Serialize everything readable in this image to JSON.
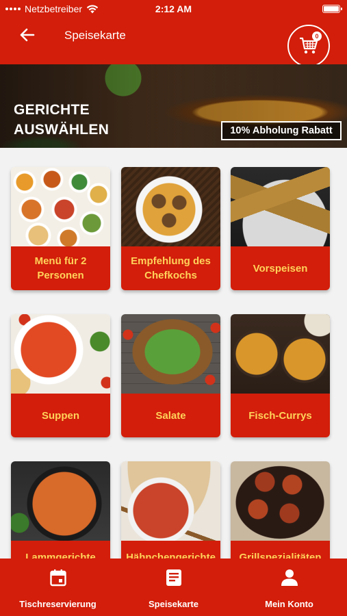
{
  "status_bar": {
    "carrier": "Netzbetreiber",
    "time": "2:12 AM",
    "icons": [
      "signal-dots-icon",
      "wifi-icon",
      "battery-icon"
    ]
  },
  "header": {
    "title": "Speisekarte",
    "back_icon": "arrow-left-icon",
    "cart_icon": "shopping-cart-icon",
    "cart_count": "0"
  },
  "banner": {
    "title": "GERICHTE AUSWÄHLEN",
    "badge": "10% Abholung Rabatt"
  },
  "categories": [
    {
      "label": "Menü für 2 Personen"
    },
    {
      "label": "Empfehlung des Chefkochs"
    },
    {
      "label": "Vorspeisen"
    },
    {
      "label": "Suppen"
    },
    {
      "label": "Salate"
    },
    {
      "label": "Fisch-Currys"
    },
    {
      "label": "Lammgerichte"
    },
    {
      "label": "Hähnchengerichte"
    },
    {
      "label": "Grillspezialitäten"
    }
  ],
  "bottom_nav": {
    "tabs": [
      {
        "label": "Tischreservierung",
        "icon": "calendar-icon"
      },
      {
        "label": "Speisekarte",
        "icon": "menu-list-icon"
      },
      {
        "label": "Mein Konto",
        "icon": "user-icon"
      }
    ]
  },
  "colors": {
    "brand_red": "#d21e0a",
    "label_yellow": "#ffd35a",
    "background": "#f2f2f2"
  }
}
